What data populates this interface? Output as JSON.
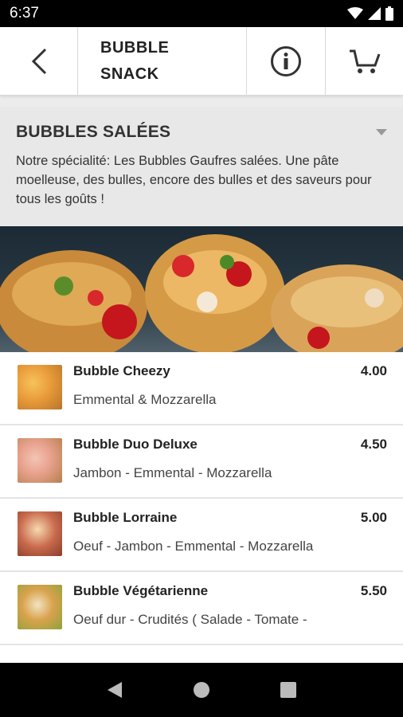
{
  "status_bar": {
    "time": "6:37"
  },
  "header": {
    "title": "BUBBLE SNACK"
  },
  "category": {
    "title": "BUBBLES SALÉES",
    "description": "Notre spécialité: Les Bubbles Gaufres salées. Une pâte moelleuse, des bulles, encore des bulles et des saveurs pour tous les goûts !"
  },
  "items": [
    {
      "name": "Bubble Cheezy",
      "price": "4.00",
      "desc": "Emmental & Mozzarella"
    },
    {
      "name": "Bubble Duo Deluxe",
      "price": "4.50",
      "desc": "Jambon - Emmental - Mozzarella"
    },
    {
      "name": "Bubble Lorraine",
      "price": "5.00",
      "desc": "Oeuf - Jambon - Emmental - Mozzarella"
    },
    {
      "name": "Bubble Végétarienne",
      "price": "5.50",
      "desc": "Oeuf dur - Crudités ( Salade - Tomate -"
    }
  ],
  "colors": {
    "header_bg": "#ffffff",
    "category_bg": "#e8e8e8",
    "status_bg": "#000000"
  },
  "icons": {
    "back": "chevron-left-icon",
    "info": "info-icon",
    "cart": "cart-icon"
  }
}
